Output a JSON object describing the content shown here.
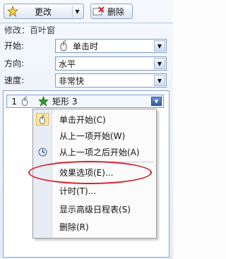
{
  "toolbar": {
    "change_label": "更改",
    "delete_label": "删除"
  },
  "modify": {
    "text": "修改：百叶窗"
  },
  "fields": {
    "start": {
      "label": "开始:",
      "value": "单击时"
    },
    "direction": {
      "label": "方向:",
      "value": "水平"
    },
    "speed": {
      "label": "速度:",
      "value": "非常快"
    }
  },
  "animation_item": {
    "number": "1",
    "label": "矩形 3"
  },
  "context_menu": {
    "items": [
      {
        "label": "单击开始(C)"
      },
      {
        "label": "从上一项开始(W)"
      },
      {
        "label": "从上一项之后开始(A)"
      },
      {
        "label": "效果选项(E)..."
      },
      {
        "label": "计时(T)..."
      },
      {
        "label": "显示高级日程表(S)"
      },
      {
        "label": "删除(R)"
      }
    ]
  },
  "colors": {
    "accent_blue": "#2c5ba8",
    "highlight_ellipse": "#d81e2a",
    "star_green": "#2e9a2a"
  }
}
